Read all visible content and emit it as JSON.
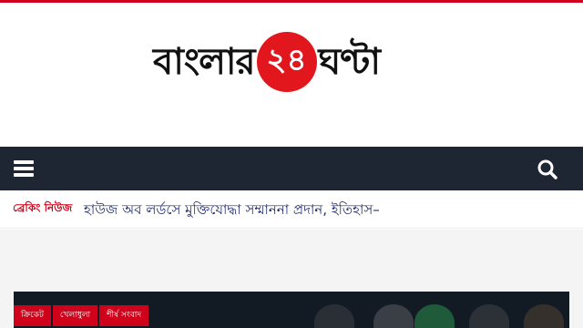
{
  "brand": {
    "part1": "বাংলার",
    "badge": "২৪",
    "part2": "ঘণ্টা",
    "accent_color": "#e2171d"
  },
  "navbar": {
    "background": "#1e2633",
    "menu_icon": "hamburger-menu-icon",
    "search_icon": "search-icon"
  },
  "breaking": {
    "label": "ব্রেকিং নিউজ",
    "headline": "হাউজ অব লর্ডসে মুক্তিযোদ্ধা সম্মাননা প্রদান, ইতিহাস–"
  },
  "featured": {
    "tags": [
      "ক্রিকেট",
      "খেলাধুলা",
      "শীর্ষ সংবাদ"
    ]
  }
}
